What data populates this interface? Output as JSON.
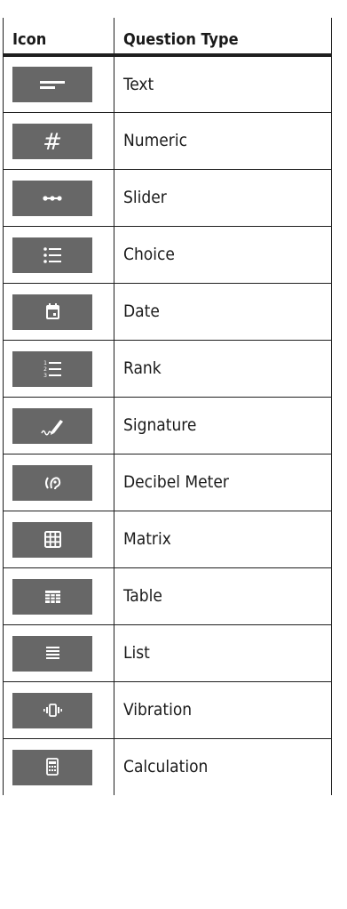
{
  "table": {
    "headers": {
      "icon": "Icon",
      "type": "Question Type"
    },
    "rows": [
      {
        "label": "Text",
        "icon": "text-lines-icon"
      },
      {
        "label": "Numeric",
        "icon": "hash-icon"
      },
      {
        "label": "Slider",
        "icon": "slider-dots-icon"
      },
      {
        "label": "Choice",
        "icon": "bulleted-list-icon"
      },
      {
        "label": "Date",
        "icon": "calendar-icon"
      },
      {
        "label": "Rank",
        "icon": "numbered-list-icon"
      },
      {
        "label": "Signature",
        "icon": "signature-pen-icon"
      },
      {
        "label": "Decibel Meter",
        "icon": "ear-icon"
      },
      {
        "label": "Matrix",
        "icon": "grid-3x3-icon"
      },
      {
        "label": "Table",
        "icon": "table-icon"
      },
      {
        "label": "List",
        "icon": "list-lines-icon"
      },
      {
        "label": "Vibration",
        "icon": "vibration-icon"
      },
      {
        "label": "Calculation",
        "icon": "calculator-icon"
      }
    ]
  },
  "colors": {
    "icon_background": "#676767",
    "icon_glyph": "#ffffff",
    "border": "#1f1f1f"
  }
}
